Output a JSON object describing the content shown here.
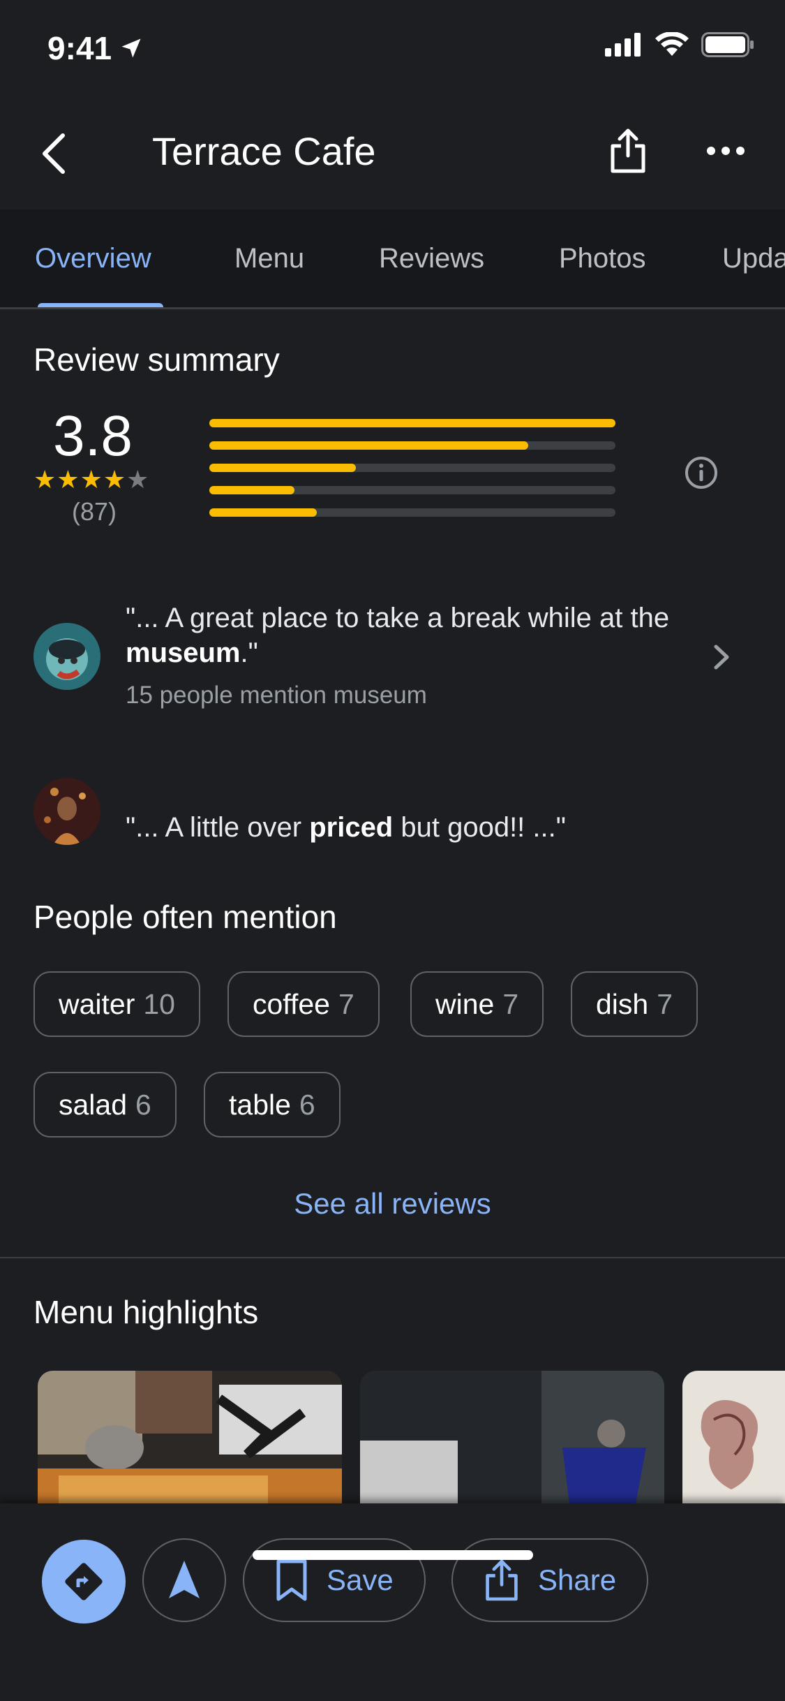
{
  "status": {
    "time": "9:41"
  },
  "header": {
    "title": "Terrace Cafe"
  },
  "tabs": [
    {
      "label": "Overview",
      "active": true
    },
    {
      "label": "Menu"
    },
    {
      "label": "Reviews"
    },
    {
      "label": "Photos"
    },
    {
      "label": "Upda"
    }
  ],
  "review_summary": {
    "title": "Review summary",
    "rating": "3.8",
    "stars_filled": 4,
    "stars_total": 5,
    "count": "(87)",
    "distribution": [
      {
        "stars": 5,
        "fraction": 1.0
      },
      {
        "stars": 4,
        "fraction": 0.785
      },
      {
        "stars": 3,
        "fraction": 0.361
      },
      {
        "stars": 2,
        "fraction": 0.209
      },
      {
        "stars": 1,
        "fraction": 0.265
      }
    ]
  },
  "quotes": [
    {
      "part1": "\"... A great place to take a break while at the ",
      "bold": "museum",
      "part2": ".\"",
      "sub": "15 people mention museum"
    },
    {
      "part1": "\"... A little over ",
      "bold": "priced",
      "part2": " but good!! ...\""
    }
  ],
  "mentions": {
    "title": "People often mention",
    "chips": [
      {
        "label": "waiter",
        "count": "10"
      },
      {
        "label": "coffee",
        "count": "7"
      },
      {
        "label": "wine",
        "count": "7"
      },
      {
        "label": "dish",
        "count": "7"
      },
      {
        "label": "salad",
        "count": "6"
      },
      {
        "label": "table",
        "count": "6"
      }
    ]
  },
  "see_all": "See all reviews",
  "menu_highlights": {
    "title": "Menu highlights"
  },
  "bottom_actions": {
    "save": "Save",
    "share": "Share"
  },
  "colors": {
    "accent": "#8ab4f8",
    "star": "#fbbc04",
    "background": "#1d1e21"
  }
}
